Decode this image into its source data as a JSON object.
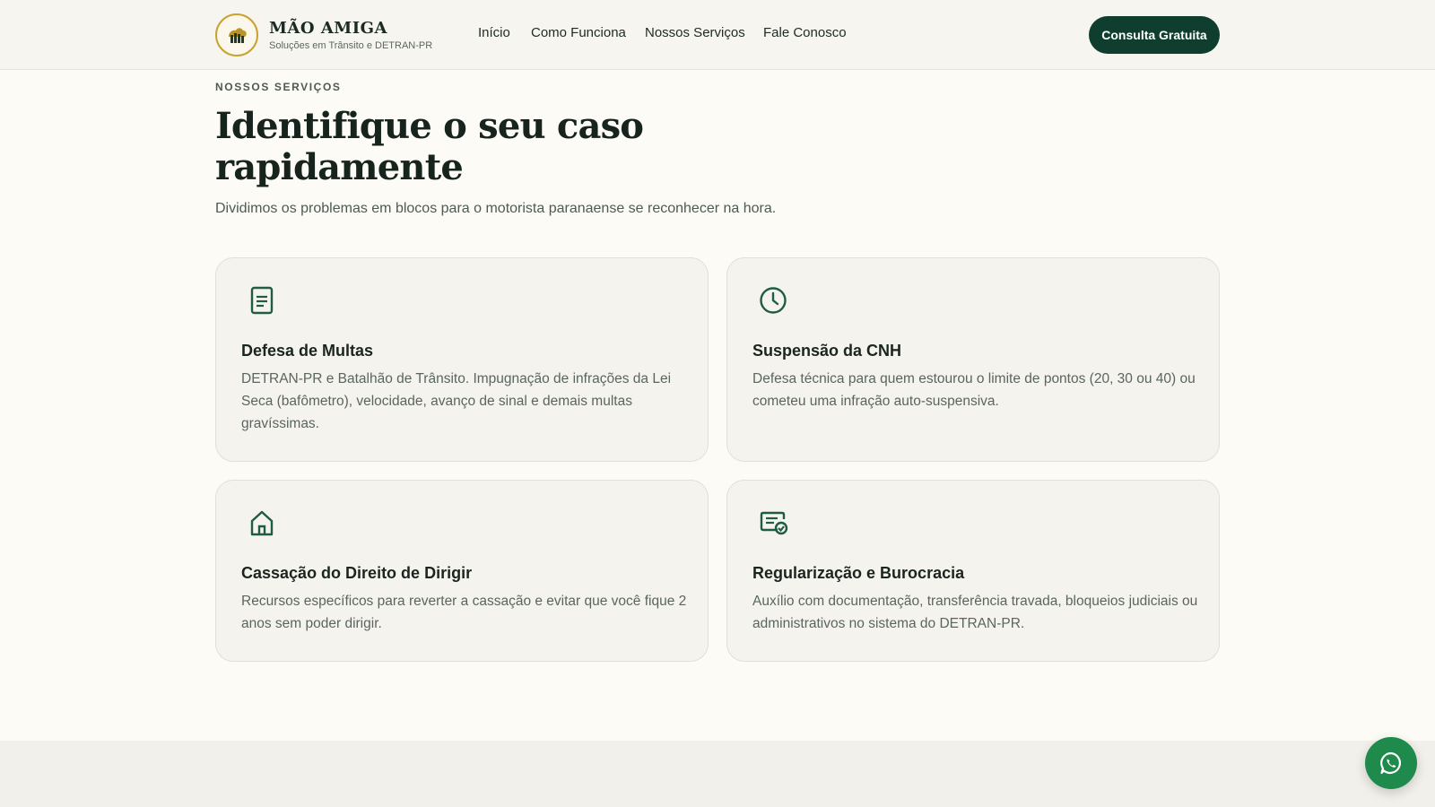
{
  "header": {
    "brand_name": "MÃO AMIGA",
    "brand_tagline": "Soluções em Trânsito e DETRAN-PR",
    "logo_icon": "hand-icon",
    "nav": [
      "Início",
      "Como Funciona",
      "Nossos Serviços",
      "Fale Conosco"
    ],
    "cta_label": "Consulta Gratuita"
  },
  "section": {
    "eyebrow": "NOSSOS SERVIÇOS",
    "title": "Identifique o seu caso rapidamente",
    "subtitle": "Dividimos os problemas em blocos para o motorista paranaense se reconhecer na hora."
  },
  "cards": [
    {
      "icon": "document-icon",
      "title": "Defesa de Multas",
      "description": "DETRAN-PR e Batalhão de Trânsito. Impugnação de infrações da Lei Seca (bafômetro), velocidade, avanço de sinal e demais multas gravíssimas."
    },
    {
      "icon": "clock-icon",
      "title": "Suspensão da CNH",
      "description": "Defesa técnica para quem estourou o limite de pontos (20, 30 ou 40) ou cometeu uma infração auto-suspensiva."
    },
    {
      "icon": "home-icon",
      "title": "Cassação do Direito de Dirigir",
      "description": "Recursos específicos para reverter a cassação e evitar que você fique 2 anos sem poder dirigir."
    },
    {
      "icon": "certificate-check-icon",
      "title": "Regularização e Burocracia",
      "description": "Auxílio com documentação, transferência travada, bloqueios judiciais ou administrativos no sistema do DETRAN-PR."
    }
  ],
  "floating": {
    "icon": "whatsapp-icon"
  },
  "colors": {
    "primary": "#0f3d2e",
    "accent_gold": "#c9a233",
    "whatsapp": "#1e8a4c",
    "background": "#fcfbf6",
    "card_bg": "#f5f3ee"
  }
}
